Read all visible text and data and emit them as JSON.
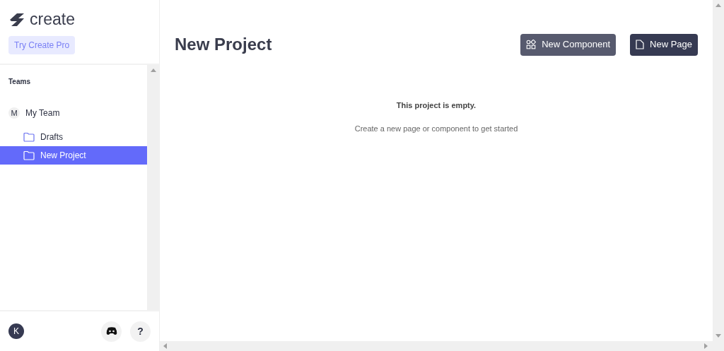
{
  "sidebar": {
    "logo": "create",
    "pro_button": "Try Create Pro",
    "section_title": "Teams",
    "team": {
      "initial": "M",
      "name": "My Team",
      "children": [
        {
          "label": "Drafts",
          "selected": false
        },
        {
          "label": "New Project",
          "selected": true
        }
      ]
    },
    "footer": {
      "avatar": "K",
      "help": "?"
    }
  },
  "main": {
    "title": "New Project",
    "buttons": [
      {
        "label": "New Component",
        "kind": "component"
      },
      {
        "label": "New Page",
        "kind": "page"
      }
    ],
    "empty_state": {
      "title": "This project is empty.",
      "subtitle": "Create a new page or component to get started"
    }
  }
}
